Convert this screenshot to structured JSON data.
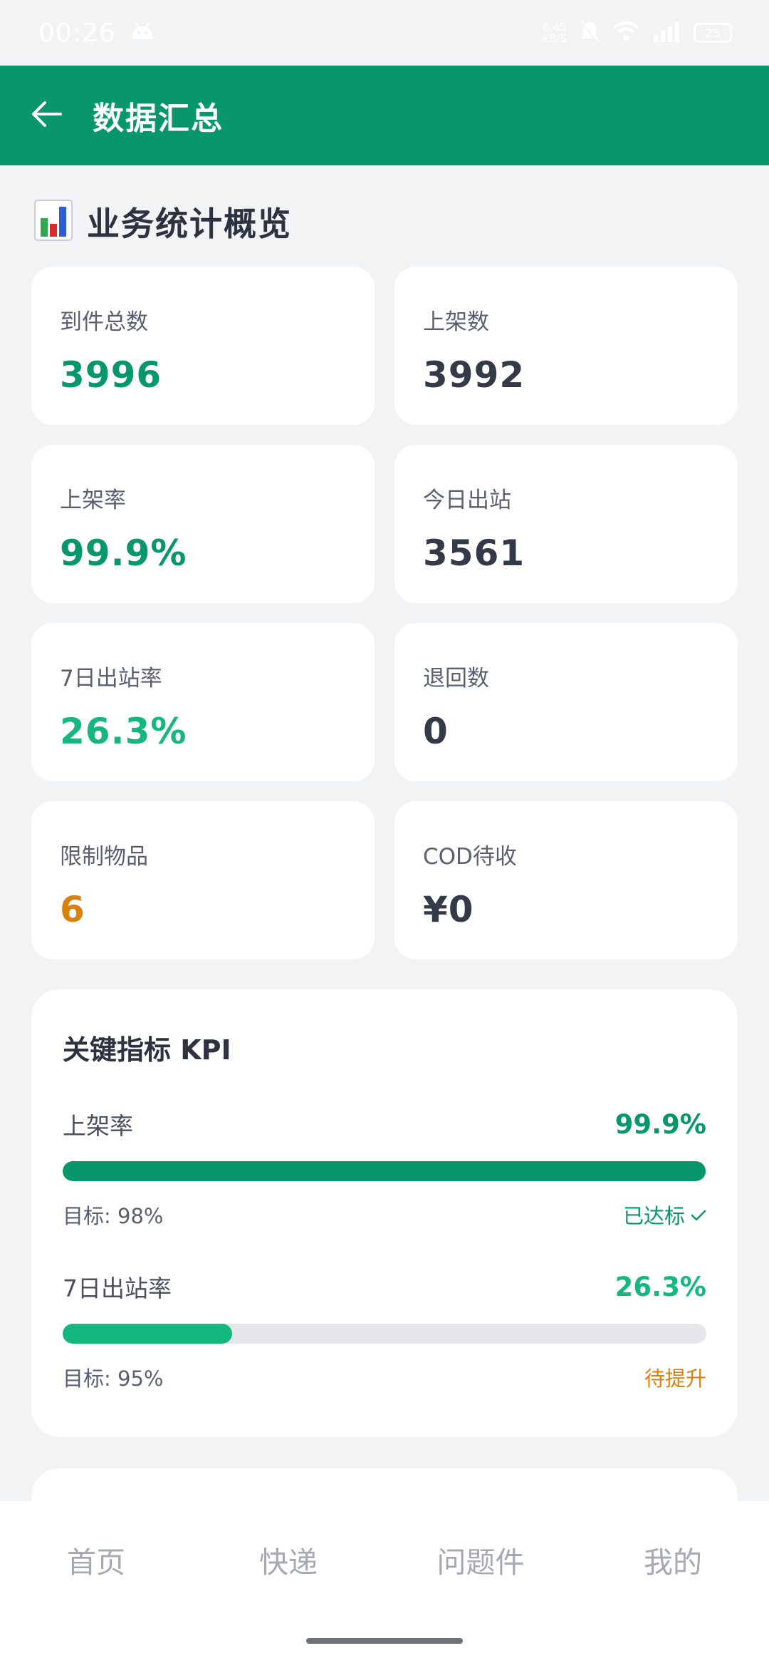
{
  "status_bar": {
    "time": "00:26",
    "net_speed_value": "6.45",
    "net_speed_unit": "KB/S",
    "battery": "25"
  },
  "app_bar": {
    "title": "数据汇总"
  },
  "overview": {
    "title": "业务统计概览",
    "stats": [
      {
        "label": "到件总数",
        "value": "3996",
        "color": "#07976a"
      },
      {
        "label": "上架数",
        "value": "3992",
        "color": "#343a48"
      },
      {
        "label": "上架率",
        "value": "99.9%",
        "color": "#07976a"
      },
      {
        "label": "今日出站",
        "value": "3561",
        "color": "#343a48"
      },
      {
        "label": "7日出站率",
        "value": "26.3%",
        "color": "#14b87f"
      },
      {
        "label": "退回数",
        "value": "0",
        "color": "#343a48"
      },
      {
        "label": "限制物品",
        "value": "6",
        "color": "#d88310"
      },
      {
        "label": "COD待收",
        "value": "¥0",
        "color": "#343a48"
      }
    ]
  },
  "kpi": {
    "title": "关键指标 KPI",
    "items": [
      {
        "name": "上架率",
        "value": "99.9%",
        "progress": 0.999,
        "target": "目标: 98%",
        "status": "已达标",
        "status_icon": "check-icon",
        "color": "#07976a"
      },
      {
        "name": "7日出站率",
        "value": "26.3%",
        "progress": 0.263,
        "target": "目标: 95%",
        "status": "待提升",
        "color": "#14b87f",
        "status_color": "#d88310"
      }
    ]
  },
  "bottom_nav": {
    "items": [
      "首页",
      "快递",
      "问题件",
      "我的"
    ]
  }
}
